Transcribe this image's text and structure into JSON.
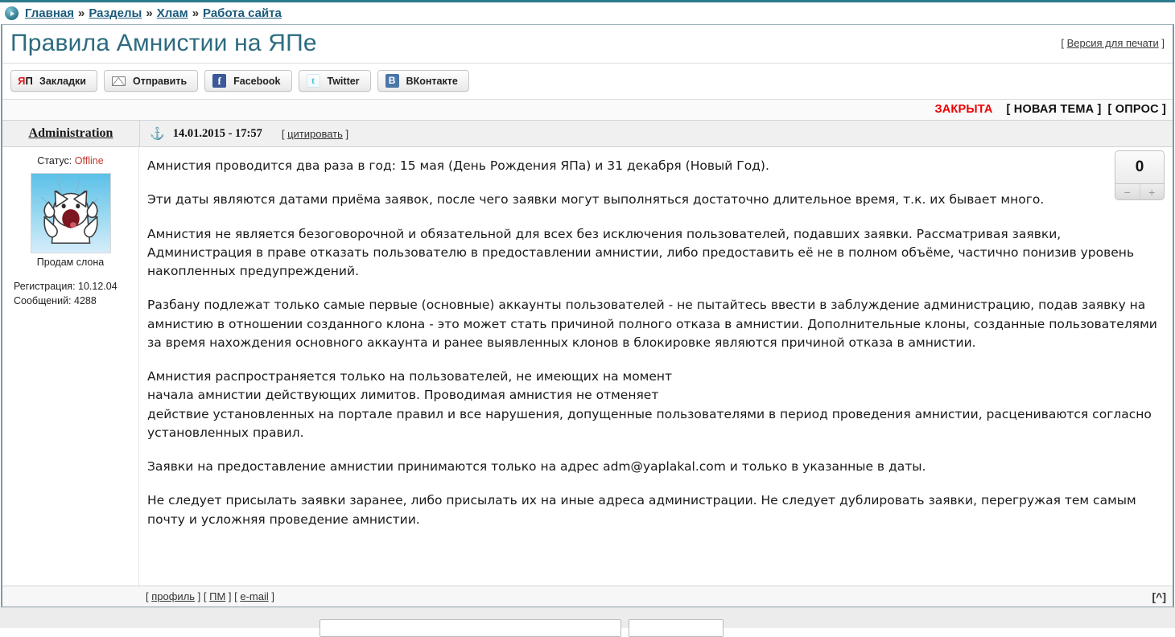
{
  "breadcrumb": {
    "icon": "play-circle-icon",
    "separator": "»",
    "items": [
      "Главная",
      "Разделы",
      "Хлам",
      "Работа сайта"
    ]
  },
  "header": {
    "title": "Правила Амнистии на ЯПе",
    "print_label": "Версия для печати",
    "bracket_open": "[",
    "bracket_close": "]"
  },
  "social": {
    "buttons": [
      {
        "label": "Закладки",
        "icon": "yap-icon"
      },
      {
        "label": "Отправить",
        "icon": "envelope-icon"
      },
      {
        "label": "Facebook",
        "icon": "facebook-icon",
        "glyph": "f"
      },
      {
        "label": "Twitter",
        "icon": "twitter-icon",
        "glyph": "t"
      },
      {
        "label": "ВКонтакте",
        "icon": "vkontakte-icon",
        "glyph": "B"
      }
    ]
  },
  "actions": {
    "closed_label": "ЗАКРЫТА",
    "new_topic": "[ НОВАЯ ТЕМА ]",
    "poll": "[ ОПРОС ]",
    "closed_color": "#ee0000"
  },
  "post": {
    "author": "Administration",
    "anchor_icon": "anchor-icon",
    "date": "14.01.2015 - 17:57",
    "quote_label": "[ цитировать ]",
    "status_label": "Статус:",
    "status_value": "Offline",
    "status_color": "#c0392b",
    "avatar_icon": "cat-avatar",
    "avatar_caption": "Продам слона",
    "registration": "Регистрация: 10.12.04",
    "messages": "Сообщений: 4288",
    "rating": {
      "value": "0",
      "minus": "−",
      "plus": "+"
    },
    "paragraphs": [
      "Амнистия проводится два раза в год: 15 мая (День Рождения ЯПа) и 31 декабря (Новый Год).",
      "Эти даты являются датами приёма заявок, после чего заявки могут выполняться достаточно длительное время, т.к. их бывает много.",
      "Амнистия не является безоговорочной и обязательной для всех без исключения пользователей, подавших заявки. Рассматривая заявки, Администрация в праве отказать пользователю в предоставлении амнистии, либо предоставить её не в полном объёме, частично понизив уровень накопленных предупреждений.",
      "Разбану подлежат только самые первые (основные) аккаунты пользователей - не пытайтесь ввести в заблуждение администрацию, подав заявку на амнистию в отношении созданного клона - это может стать причиной полного отказа в амнистии. Дополнительные клоны, созданные пользователями за время нахождения основного аккаунта и ранее выявленных клонов в блокировке являются причиной отказа в амнистии.",
      "Амнистия распространяется только на пользователей, не имеющих на момент\nначала амнистии действующих лимитов. Проводимая амнистия не отменяет\nдействие установленных на портале правил и все нарушения, допущенные пользователями в период проведения амнистии, расцениваются согласно установленных правил.",
      "Заявки на предоставление амнистии принимаются только на адрес adm@yaplakal.com и только в указанные в даты.",
      "Не следует присылать заявки заранее, либо присылать их на иные адреса администрации. Не следует дублировать заявки, перегружая тем самым почту и усложняя проведение амнистии."
    ],
    "footer": {
      "profile": "профиль",
      "pm": "ПМ",
      "email": "e-mail",
      "up_label": "[^]"
    }
  }
}
